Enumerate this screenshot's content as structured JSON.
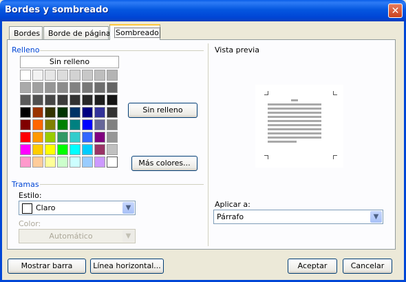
{
  "window": {
    "title": "Bordes y sombreado",
    "close_icon": "close-icon"
  },
  "tabs": [
    {
      "label": "Bordes",
      "underline": "B"
    },
    {
      "label": "Borde de página",
      "underline": "o"
    },
    {
      "label": "Sombreado",
      "underline": "S",
      "active": true
    }
  ],
  "relleno": {
    "group_label": "Relleno",
    "no_fill_bar_label": "Sin relleno",
    "swatch_colors": [
      [
        "#ffffff",
        "#f2f2f2",
        "#e6e6e6",
        "#dcdcdc",
        "#d2d2d2",
        "#c8c8c8",
        "#bebebe",
        "#b4b4b4"
      ],
      [
        "#aaaaaa",
        "#a0a0a0",
        "#969696",
        "#8c8c8c",
        "#828282",
        "#787878",
        "#6e6e6e",
        "#646464"
      ],
      [
        "#5a5a5a",
        "#505050",
        "#464646",
        "#3c3c3c",
        "#323232",
        "#282828",
        "#1e1e1e",
        "#141414"
      ],
      [
        "#000000",
        "#993300",
        "#333300",
        "#003300",
        "#003366",
        "#000080",
        "#333399",
        "#333333"
      ],
      [
        "#800000",
        "#ff6600",
        "#808000",
        "#008000",
        "#008080",
        "#0000ff",
        "#666699",
        "#808080"
      ],
      [
        "#ff0000",
        "#ff9900",
        "#99cc00",
        "#339966",
        "#33cccc",
        "#3366ff",
        "#800080",
        "#969696"
      ],
      [
        "#ff00ff",
        "#ffcc00",
        "#ffff00",
        "#00ff00",
        "#00ffff",
        "#00ccff",
        "#993366",
        "#c0c0c0"
      ],
      [
        "#ff99cc",
        "#ffcc99",
        "#ffff99",
        "#ccffcc",
        "#ccffff",
        "#99ccff",
        "#cc99ff",
        "#ffffff"
      ]
    ],
    "no_fill_button_label": "Sin relleno",
    "more_colors_label": "Más colores..."
  },
  "tramas": {
    "group_label": "Tramas",
    "style_label": "Estilo:",
    "style_value": "Claro",
    "color_label": "Color:",
    "color_value": "Automático"
  },
  "preview": {
    "label": "Vista previa",
    "apply_label": "Aplicar a:",
    "apply_value": "Párrafo"
  },
  "footer": {
    "show_toolbar": "Mostrar barra",
    "horizontal_line": "Línea horizontal...",
    "ok": "Aceptar",
    "cancel": "Cancelar"
  }
}
